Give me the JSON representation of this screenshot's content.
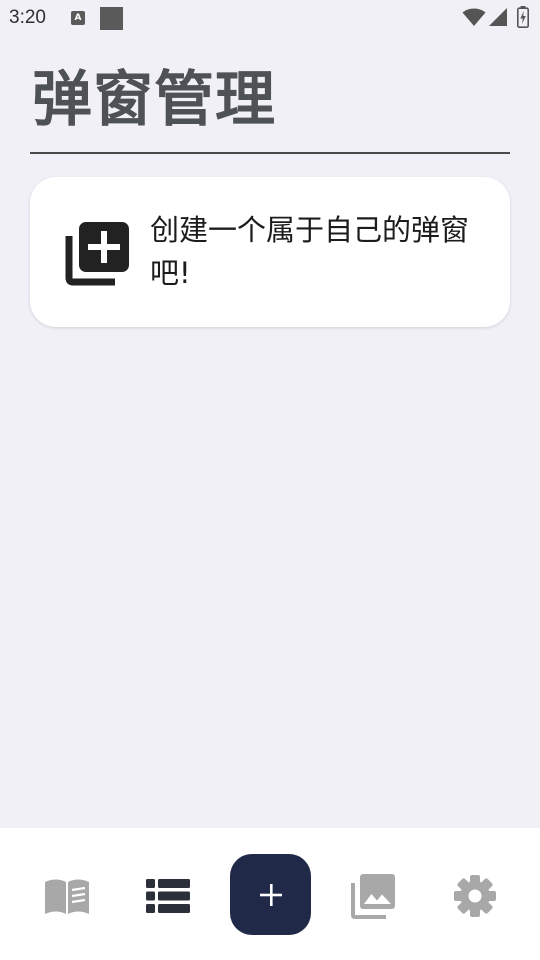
{
  "status_bar": {
    "time": "3:20",
    "a_badge": "A",
    "icons": [
      "a-notification-icon",
      "square-notification-icon",
      "wifi-icon",
      "cellular-signal-icon",
      "battery-charging-icon"
    ]
  },
  "header": {
    "title": "弹窗管理"
  },
  "create_card": {
    "icon": "add-to-collection-icon",
    "text": "创建一个属于自己的弹窗吧!"
  },
  "bottom_nav": {
    "items": [
      {
        "icon": "book-open-icon",
        "state": "inactive"
      },
      {
        "icon": "list-icon",
        "state": "active"
      },
      {
        "icon": "plus-icon",
        "state": "primary-action"
      },
      {
        "icon": "photo-library-icon",
        "state": "inactive"
      },
      {
        "icon": "gear-icon",
        "state": "inactive"
      }
    ]
  },
  "colors": {
    "background": "#f1f0f7",
    "title": "#4e5257",
    "card": "#ffffff",
    "add_button": "#202a48",
    "active_nav": "#2a2f3a",
    "inactive_nav": "#a7a7a7"
  }
}
